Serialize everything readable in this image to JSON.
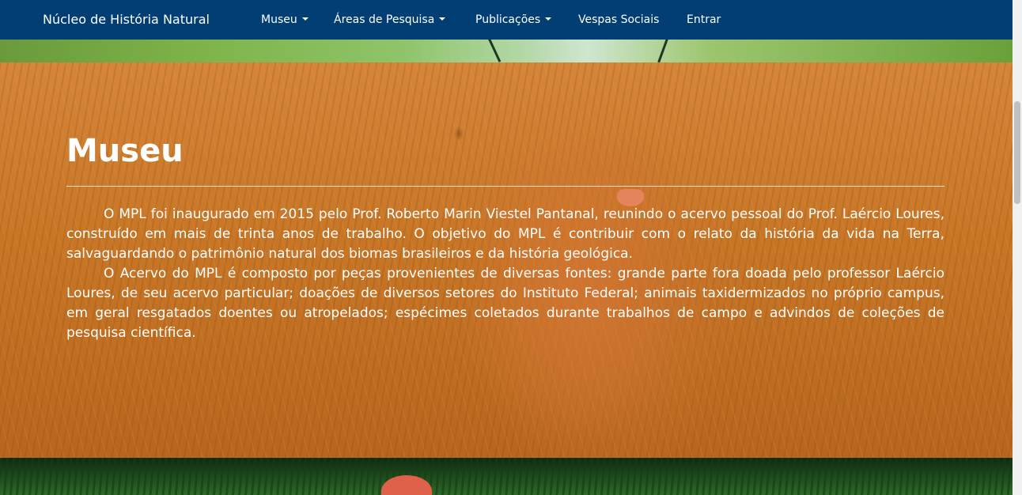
{
  "navbar": {
    "brand": "Núcleo de História Natural",
    "items": [
      {
        "label": "Museu",
        "dropdown": true
      },
      {
        "label": "Áreas de Pesquisa",
        "dropdown": true
      },
      {
        "label": "Publicações",
        "dropdown": true
      },
      {
        "label": "Vespas Sociais",
        "dropdown": false
      },
      {
        "label": "Entrar",
        "dropdown": false
      }
    ]
  },
  "section": {
    "title": "Museu",
    "paragraphs": [
      "O MPL foi inaugurado em 2015 pelo Prof. Roberto Marin Viestel Pantanal, reunindo o acervo pessoal do Prof. Laércio Loures, construído em mais de trinta anos de trabalho. O objetivo do MPL é contribuir com o relato da história da vida na Terra, salvaguardando o patrimônio natural dos biomas brasileiros e da história geológica.",
      "O Acervo do MPL é composto por peças provenientes de diversas fontes: grande parte fora doada pelo professor Laércio Loures, de seu acervo particular; doações de diversos setores do Instituto Federal; animais taxidermizados no próprio campus, em geral resgatados doentes ou atropelados; espécimes coletados durante trabalhos de campo e advindos de coleções de pesquisa científica."
    ]
  },
  "colors": {
    "navbar": "#003e73",
    "hero_overlay": "#c87626",
    "text": "#ffffff"
  },
  "icons": {
    "dropdown": "caret-down-icon"
  }
}
